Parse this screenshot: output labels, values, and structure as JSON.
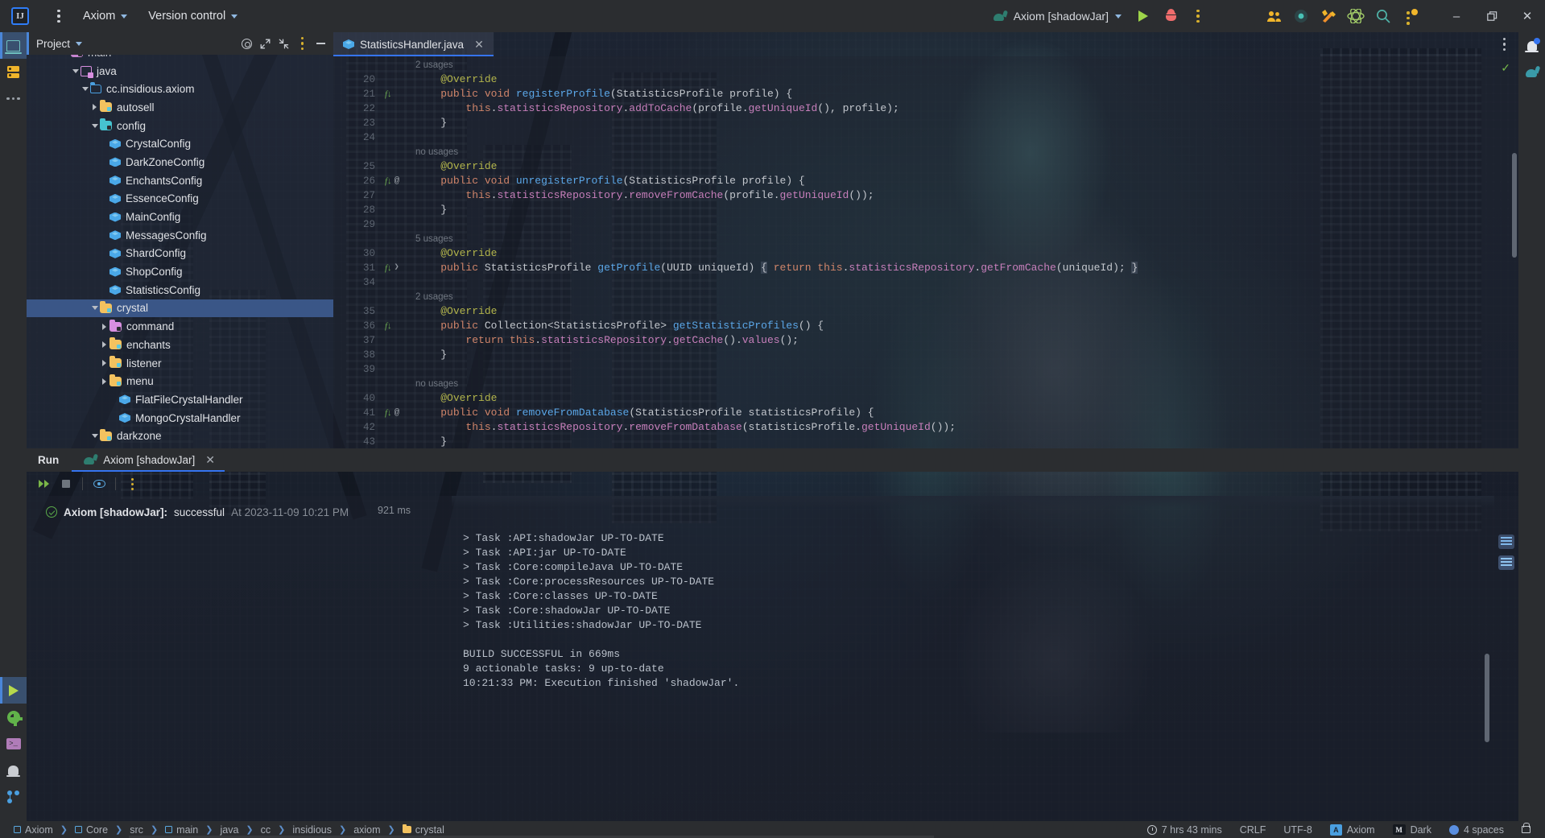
{
  "titlebar": {
    "logo_label": "IJ",
    "menu_icon": "main-menu-icon",
    "project_menu": "Axiom",
    "vcs_menu": "Version control",
    "run_config": "Axiom [shadowJar]",
    "run_config_icon": "gradle-elephant-icon",
    "run_icon": "run-icon",
    "debug_icon": "debug-icon",
    "more_icon": "more-actions-icon",
    "right_icons": [
      {
        "name": "code-with-me-icon",
        "glyph": "users"
      },
      {
        "name": "recording-icon",
        "glyph": "dot"
      },
      {
        "name": "tools-icon",
        "glyph": "tools"
      },
      {
        "name": "atom-plugin-icon",
        "glyph": "atom"
      },
      {
        "name": "search-everywhere-icon",
        "glyph": "search"
      },
      {
        "name": "notifications-menu-icon",
        "glyph": "vdots"
      }
    ],
    "minimize": "–",
    "maximize": "❐",
    "close": "✕"
  },
  "left_activity_bar": {
    "top": [
      {
        "name": "project-tool-window",
        "icon": "project-icon",
        "active": true
      },
      {
        "name": "database-tool-window",
        "icon": "database-icon",
        "active": false
      },
      {
        "name": "more-tool-windows",
        "icon": "more-icon",
        "active": false
      }
    ],
    "bottom": [
      {
        "name": "run-tool-window",
        "icon": "run-icon",
        "active": true
      },
      {
        "name": "services-tool-window",
        "icon": "gear-icon",
        "active": false
      },
      {
        "name": "terminal-tool-window",
        "icon": "terminal-icon",
        "active": false
      },
      {
        "name": "problems-tool-window",
        "icon": "bell-icon",
        "active": false
      },
      {
        "name": "version-control-tool-window",
        "icon": "branch-icon",
        "active": false
      }
    ]
  },
  "right_activity_bar": [
    {
      "name": "notifications-button",
      "icon": "bell-icon"
    },
    {
      "name": "gradle-tool-window",
      "icon": "gradle-elephant-icon"
    }
  ],
  "project_panel": {
    "title": "Project",
    "actions": [
      {
        "name": "select-opened-file-button",
        "icon": "target-icon"
      },
      {
        "name": "expand-all-button",
        "icon": "expand-icon"
      },
      {
        "name": "collapse-all-button",
        "icon": "collapse-icon"
      },
      {
        "name": "hide-button",
        "icon": "minus-icon"
      }
    ],
    "tree": [
      {
        "label": "main",
        "indent": 3,
        "arrow": "down",
        "icon": "source-folder",
        "selected": false,
        "cut": true
      },
      {
        "label": "java",
        "indent": 4,
        "arrow": "down",
        "icon": "module-folder",
        "selected": false
      },
      {
        "label": "cc.insidious.axiom",
        "indent": 5,
        "arrow": "down",
        "icon": "package",
        "selected": false
      },
      {
        "label": "autosell",
        "indent": 6,
        "arrow": "right",
        "icon": "folder",
        "selected": false
      },
      {
        "label": "config",
        "indent": 6,
        "arrow": "down",
        "icon": "folder-config",
        "selected": false
      },
      {
        "label": "CrystalConfig",
        "indent": 7,
        "arrow": "none",
        "icon": "class",
        "selected": false
      },
      {
        "label": "DarkZoneConfig",
        "indent": 7,
        "arrow": "none",
        "icon": "class",
        "selected": false
      },
      {
        "label": "EnchantsConfig",
        "indent": 7,
        "arrow": "none",
        "icon": "class",
        "selected": false
      },
      {
        "label": "EssenceConfig",
        "indent": 7,
        "arrow": "none",
        "icon": "class",
        "selected": false
      },
      {
        "label": "MainConfig",
        "indent": 7,
        "arrow": "none",
        "icon": "class",
        "selected": false
      },
      {
        "label": "MessagesConfig",
        "indent": 7,
        "arrow": "none",
        "icon": "class",
        "selected": false
      },
      {
        "label": "ShardConfig",
        "indent": 7,
        "arrow": "none",
        "icon": "class",
        "selected": false
      },
      {
        "label": "ShopConfig",
        "indent": 7,
        "arrow": "none",
        "icon": "class",
        "selected": false
      },
      {
        "label": "StatisticsConfig",
        "indent": 7,
        "arrow": "none",
        "icon": "class",
        "selected": false
      },
      {
        "label": "crystal",
        "indent": 6,
        "arrow": "down",
        "icon": "folder",
        "selected": true
      },
      {
        "label": "command",
        "indent": 7,
        "arrow": "right",
        "icon": "folder-command",
        "selected": false
      },
      {
        "label": "enchants",
        "indent": 7,
        "arrow": "right",
        "icon": "folder",
        "selected": false
      },
      {
        "label": "listener",
        "indent": 7,
        "arrow": "right",
        "icon": "folder",
        "selected": false
      },
      {
        "label": "menu",
        "indent": 7,
        "arrow": "right",
        "icon": "folder",
        "selected": false
      },
      {
        "label": "FlatFileCrystalHandler",
        "indent": 8,
        "arrow": "none",
        "icon": "class",
        "selected": false
      },
      {
        "label": "MongoCrystalHandler",
        "indent": 8,
        "arrow": "none",
        "icon": "class",
        "selected": false
      },
      {
        "label": "darkzone",
        "indent": 6,
        "arrow": "down",
        "icon": "folder",
        "selected": false
      }
    ]
  },
  "editor": {
    "tab": {
      "label": "StatisticsHandler.java",
      "icon": "java-class-icon",
      "close": "✕"
    },
    "options_icon": "editor-options-icon",
    "inspection_status": "✓",
    "lines": [
      {
        "num": "",
        "mark": "",
        "usages": "2 usages",
        "indent": 0,
        "tokens": []
      },
      {
        "num": "20",
        "mark": "",
        "indent": 1,
        "tokens": [
          {
            "t": "@Override",
            "c": "an"
          }
        ]
      },
      {
        "num": "21",
        "mark": "impl",
        "indent": 1,
        "tokens": [
          {
            "t": "public",
            "c": "k"
          },
          {
            "t": " ",
            "c": "p"
          },
          {
            "t": "void",
            "c": "k"
          },
          {
            "t": " ",
            "c": "p"
          },
          {
            "t": "registerProfile",
            "c": "m"
          },
          {
            "t": "(StatisticsProfile profile) {",
            "c": "t"
          }
        ]
      },
      {
        "num": "22",
        "mark": "",
        "indent": 2,
        "tokens": [
          {
            "t": "this",
            "c": "k"
          },
          {
            "t": ".",
            "c": "t"
          },
          {
            "t": "statisticsRepository",
            "c": "f"
          },
          {
            "t": ".",
            "c": "t"
          },
          {
            "t": "addToCache",
            "c": "f"
          },
          {
            "t": "(profile.",
            "c": "t"
          },
          {
            "t": "getUniqueId",
            "c": "f"
          },
          {
            "t": "(), profile);",
            "c": "t"
          }
        ]
      },
      {
        "num": "23",
        "mark": "",
        "indent": 1,
        "tokens": [
          {
            "t": "}",
            "c": "t"
          }
        ]
      },
      {
        "num": "24",
        "mark": "",
        "indent": 0,
        "tokens": []
      },
      {
        "num": "",
        "mark": "",
        "usages": "no usages",
        "indent": 0,
        "tokens": []
      },
      {
        "num": "25",
        "mark": "",
        "indent": 1,
        "tokens": [
          {
            "t": "@Override",
            "c": "an"
          }
        ]
      },
      {
        "num": "26",
        "mark": "impl-at",
        "indent": 1,
        "tokens": [
          {
            "t": "public",
            "c": "k"
          },
          {
            "t": " ",
            "c": "p"
          },
          {
            "t": "void",
            "c": "k"
          },
          {
            "t": " ",
            "c": "p"
          },
          {
            "t": "unregisterProfile",
            "c": "m"
          },
          {
            "t": "(StatisticsProfile profile) {",
            "c": "t"
          }
        ]
      },
      {
        "num": "27",
        "mark": "",
        "indent": 2,
        "tokens": [
          {
            "t": "this",
            "c": "k"
          },
          {
            "t": ".",
            "c": "t"
          },
          {
            "t": "statisticsRepository",
            "c": "f"
          },
          {
            "t": ".",
            "c": "t"
          },
          {
            "t": "removeFromCache",
            "c": "f"
          },
          {
            "t": "(profile.",
            "c": "t"
          },
          {
            "t": "getUniqueId",
            "c": "f"
          },
          {
            "t": "());",
            "c": "t"
          }
        ]
      },
      {
        "num": "28",
        "mark": "",
        "indent": 1,
        "tokens": [
          {
            "t": "}",
            "c": "t"
          }
        ]
      },
      {
        "num": "29",
        "mark": "",
        "indent": 0,
        "tokens": []
      },
      {
        "num": "",
        "mark": "",
        "usages": "5 usages",
        "indent": 0,
        "tokens": []
      },
      {
        "num": "30",
        "mark": "",
        "indent": 1,
        "tokens": [
          {
            "t": "@Override",
            "c": "an"
          }
        ]
      },
      {
        "num": "31",
        "mark": "impl-fold",
        "indent": 1,
        "tokens": [
          {
            "t": "public",
            "c": "k"
          },
          {
            "t": " StatisticsProfile ",
            "c": "t"
          },
          {
            "t": "getProfile",
            "c": "m"
          },
          {
            "t": "(UUID uniqueId) ",
            "c": "t"
          },
          {
            "t": "{",
            "c": "hl"
          },
          {
            "t": " ",
            "c": "t"
          },
          {
            "t": "return",
            "c": "k"
          },
          {
            "t": " ",
            "c": "t"
          },
          {
            "t": "this",
            "c": "k"
          },
          {
            "t": ".",
            "c": "t"
          },
          {
            "t": "statisticsRepository",
            "c": "f"
          },
          {
            "t": ".",
            "c": "t"
          },
          {
            "t": "getFromCache",
            "c": "f"
          },
          {
            "t": "(uniqueId); ",
            "c": "t"
          },
          {
            "t": "}",
            "c": "hl"
          }
        ]
      },
      {
        "num": "34",
        "mark": "",
        "indent": 0,
        "tokens": []
      },
      {
        "num": "",
        "mark": "",
        "usages": "2 usages",
        "indent": 0,
        "tokens": []
      },
      {
        "num": "35",
        "mark": "",
        "indent": 1,
        "tokens": [
          {
            "t": "@Override",
            "c": "an"
          }
        ]
      },
      {
        "num": "36",
        "mark": "impl",
        "indent": 1,
        "tokens": [
          {
            "t": "public",
            "c": "k"
          },
          {
            "t": " Collection<StatisticsProfile> ",
            "c": "t"
          },
          {
            "t": "getStatisticProfiles",
            "c": "m"
          },
          {
            "t": "() {",
            "c": "t"
          }
        ]
      },
      {
        "num": "37",
        "mark": "",
        "indent": 2,
        "tokens": [
          {
            "t": "return",
            "c": "k"
          },
          {
            "t": " ",
            "c": "t"
          },
          {
            "t": "this",
            "c": "k"
          },
          {
            "t": ".",
            "c": "t"
          },
          {
            "t": "statisticsRepository",
            "c": "f"
          },
          {
            "t": ".",
            "c": "t"
          },
          {
            "t": "getCache",
            "c": "f"
          },
          {
            "t": "().",
            "c": "t"
          },
          {
            "t": "values",
            "c": "f"
          },
          {
            "t": "();",
            "c": "t"
          }
        ]
      },
      {
        "num": "38",
        "mark": "",
        "indent": 1,
        "tokens": [
          {
            "t": "}",
            "c": "t"
          }
        ]
      },
      {
        "num": "39",
        "mark": "",
        "indent": 0,
        "tokens": []
      },
      {
        "num": "",
        "mark": "",
        "usages": "no usages",
        "indent": 0,
        "tokens": []
      },
      {
        "num": "40",
        "mark": "",
        "indent": 1,
        "tokens": [
          {
            "t": "@Override",
            "c": "an"
          }
        ]
      },
      {
        "num": "41",
        "mark": "impl-at",
        "indent": 1,
        "tokens": [
          {
            "t": "public",
            "c": "k"
          },
          {
            "t": " ",
            "c": "p"
          },
          {
            "t": "void",
            "c": "k"
          },
          {
            "t": " ",
            "c": "p"
          },
          {
            "t": "removeFromDatabase",
            "c": "m"
          },
          {
            "t": "(StatisticsProfile statisticsProfile) {",
            "c": "t"
          }
        ]
      },
      {
        "num": "42",
        "mark": "",
        "indent": 2,
        "tokens": [
          {
            "t": "this",
            "c": "k"
          },
          {
            "t": ".",
            "c": "t"
          },
          {
            "t": "statisticsRepository",
            "c": "f"
          },
          {
            "t": ".",
            "c": "t"
          },
          {
            "t": "removeFromDatabase",
            "c": "f"
          },
          {
            "t": "(statisticsProfile.",
            "c": "t"
          },
          {
            "t": "getUniqueId",
            "c": "f"
          },
          {
            "t": "());",
            "c": "t"
          }
        ]
      },
      {
        "num": "43",
        "mark": "",
        "indent": 1,
        "tokens": [
          {
            "t": "}",
            "c": "t"
          }
        ]
      }
    ]
  },
  "run_panel": {
    "title": "Run",
    "tab": {
      "label": "Axiom [shadowJar]",
      "icon": "gradle-elephant-icon",
      "close": "✕"
    },
    "toolbar": [
      {
        "name": "rerun-button",
        "icon": "rerun-icon"
      },
      {
        "name": "stop-button",
        "icon": "stop-icon"
      },
      {
        "name": "toggle-view-button",
        "icon": "eye-icon"
      },
      {
        "name": "more-options-button",
        "icon": "vdots-icon"
      }
    ],
    "build_status": {
      "icon": "success-check-icon",
      "name": "Axiom [shadowJar]:",
      "state": "successful",
      "timestamp": "At 2023-11-09 10:21 PM",
      "duration": "921 ms"
    },
    "console": [
      "> Task :API:shadowJar UP-TO-DATE",
      "> Task :API:jar UP-TO-DATE",
      "> Task :Core:compileJava UP-TO-DATE",
      "> Task :Core:processResources UP-TO-DATE",
      "> Task :Core:classes UP-TO-DATE",
      "> Task :Core:shadowJar UP-TO-DATE",
      "> Task :Utilities:shadowJar UP-TO-DATE",
      "",
      "BUILD SUCCESSFUL in 669ms",
      "9 actionable tasks: 9 up-to-date",
      "10:21:33 PM: Execution finished 'shadowJar'."
    ]
  },
  "statusbar": {
    "breadcrumb": [
      {
        "label": "Axiom",
        "icon": "module-icon"
      },
      {
        "label": "Core",
        "icon": "module-icon"
      },
      {
        "label": "src",
        "icon": "none"
      },
      {
        "label": "main",
        "icon": "module-icon"
      },
      {
        "label": "java",
        "icon": "none"
      },
      {
        "label": "cc",
        "icon": "none"
      },
      {
        "label": "insidious",
        "icon": "none"
      },
      {
        "label": "axiom",
        "icon": "none"
      },
      {
        "label": "crystal",
        "icon": "folder-icon"
      }
    ],
    "separator": "❯",
    "right": {
      "time_tracking": "7 hrs 43 mins",
      "line_separator": "CRLF",
      "encoding": "UTF-8",
      "keymap_badge": "A",
      "keymap_label": "Axiom",
      "theme_badge": "M",
      "theme_label": "Dark",
      "indent": "4 spaces",
      "lock_icon": "unlocked-icon"
    }
  },
  "colors": {
    "accent_blue": "#3574f0",
    "selection_blue": "#3a5687",
    "toolbar_bg": "#2b2d30",
    "success_green": "#5aaa4a"
  }
}
